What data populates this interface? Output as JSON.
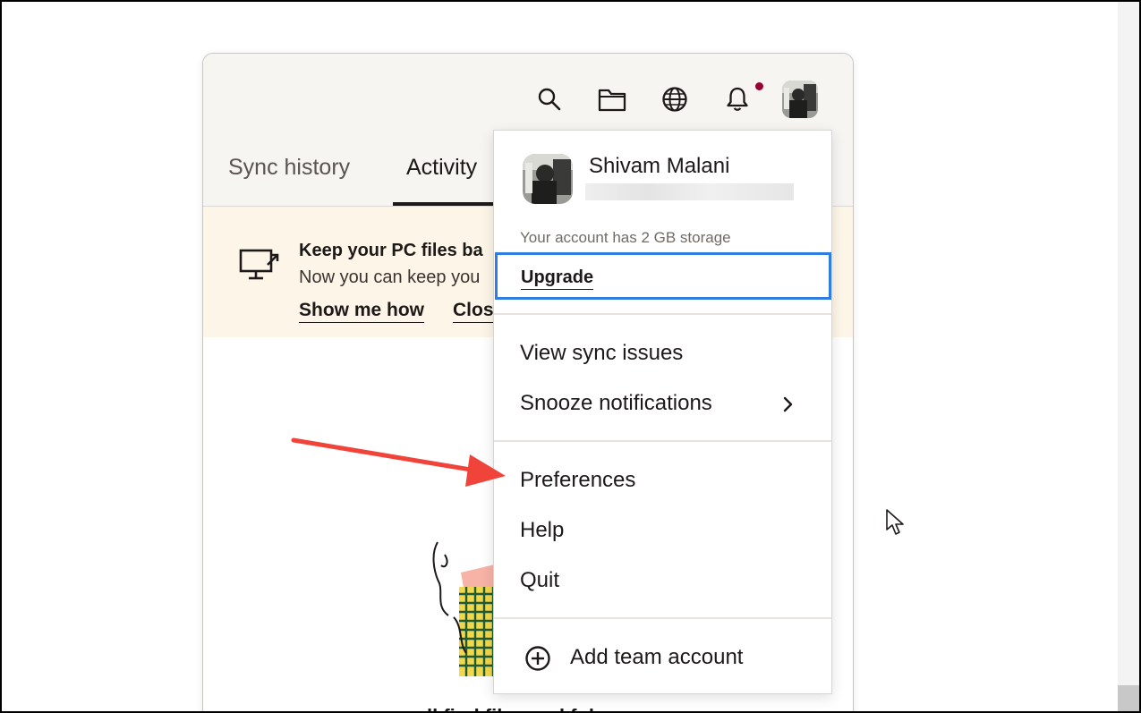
{
  "header": {
    "icons": [
      "search-icon",
      "folder-icon",
      "globe-icon",
      "bell-icon"
    ],
    "notification_dot_color": "#9b0032"
  },
  "tabs": [
    {
      "label": "Sync history",
      "active": false
    },
    {
      "label": "Activity",
      "active": true
    }
  ],
  "banner": {
    "title": "Keep your PC files ba",
    "text": "Now you can keep you",
    "links": [
      "Show me how",
      "Clos"
    ]
  },
  "empty_state": {
    "text": "ll find files and fol"
  },
  "menu": {
    "user_name": "Shivam Malani",
    "storage_text": "Your account has 2 GB storage",
    "upgrade_label": "Upgrade",
    "items_group1": [
      "View sync issues",
      "Snooze notifications"
    ],
    "items_group2": [
      "Preferences",
      "Help",
      "Quit"
    ],
    "add_team_label": "Add team account",
    "highlight_color": "#2f7de1"
  },
  "annotation": {
    "arrow_color": "#f0443a",
    "arrow_target": "Preferences"
  }
}
